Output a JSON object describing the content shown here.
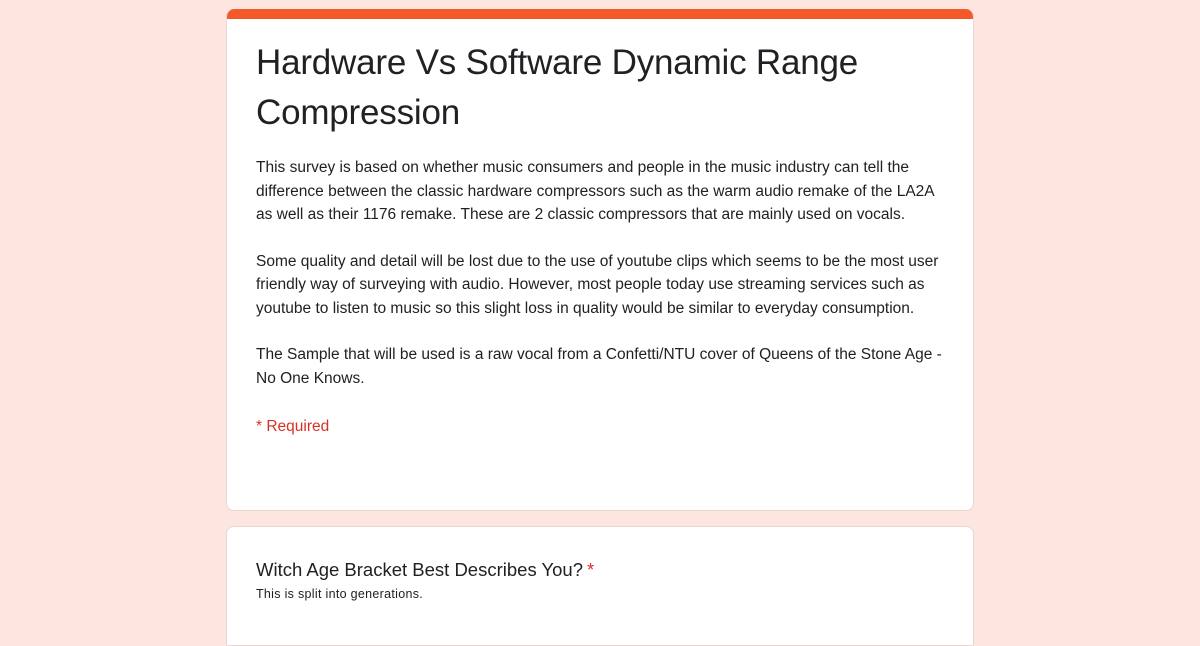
{
  "form": {
    "accent_color": "#f4592a",
    "title": "Hardware Vs Software Dynamic Range Compression",
    "description": [
      "This survey is based on whether music consumers and people in the music industry can tell the difference between the classic hardware compressors such as the warm audio remake of the LA2A as well as their 1176 remake. These are 2 classic compressors that are mainly used on vocals.",
      "Some quality and detail will be lost due to the use of youtube clips which seems to be the most user friendly way of surveying with audio. However, most people today use streaming services such as youtube to listen to music so this slight loss in quality would be similar to everyday consumption.",
      "The Sample that will be used is a raw vocal from a Confetti/NTU cover of Queens of the Stone Age - No One Knows."
    ],
    "required_note": "* Required"
  },
  "questions": [
    {
      "title": "Witch Age Bracket Best Describes You?",
      "required_marker": "*",
      "help_text": "This is split into generations."
    }
  ]
}
